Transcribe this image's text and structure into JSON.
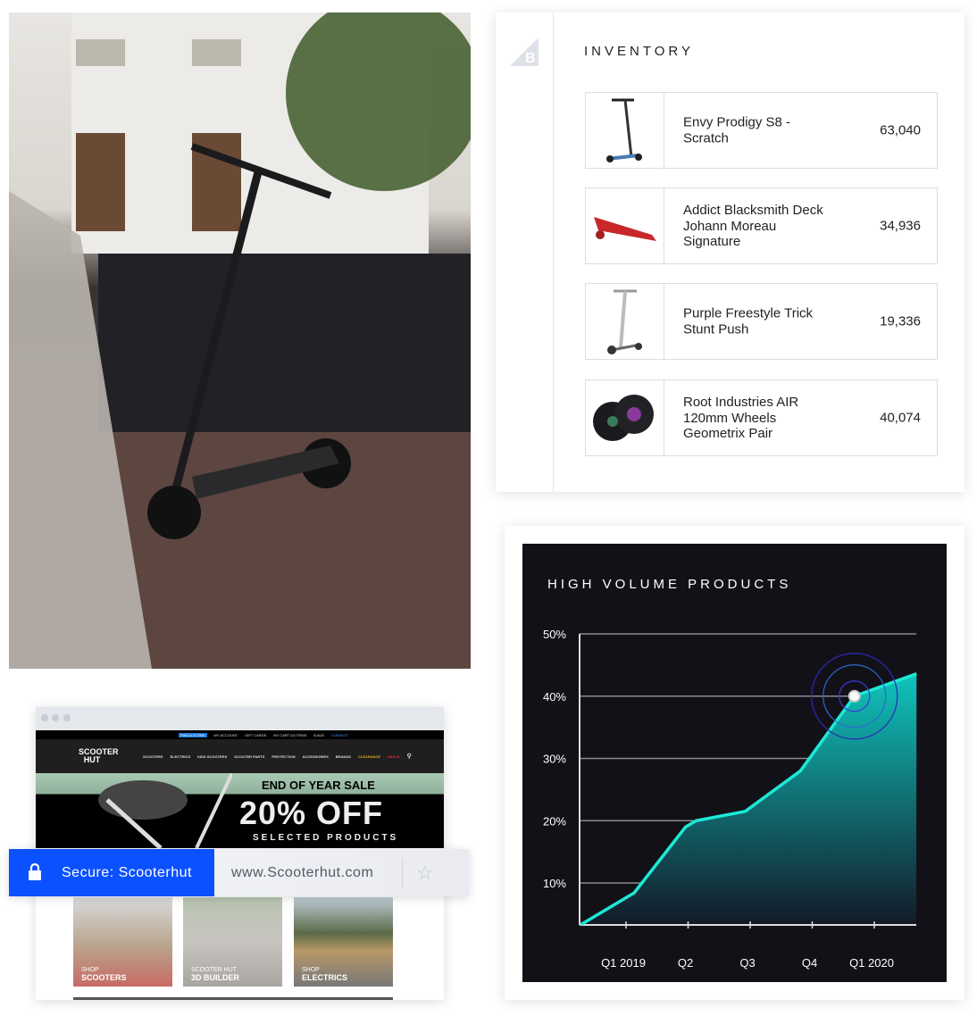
{
  "inventory": {
    "title": "INVENTORY",
    "logo": "B",
    "items": [
      {
        "name": "Envy Prodigy S8 - Scratch",
        "qty": "63,040",
        "thumb": "stunt-scooter"
      },
      {
        "name": "Addict Blacksmith Deck Johann Moreau Signature",
        "qty": "34,936",
        "thumb": "red-deck"
      },
      {
        "name": "Purple Freestyle Trick Stunt Push",
        "qty": "19,336",
        "thumb": "silver-scooter"
      },
      {
        "name": "Root Industries AIR 120mm Wheels Geometrix Pair",
        "qty": "40,074",
        "thumb": "wheels"
      }
    ]
  },
  "chart_data": {
    "type": "area",
    "title": "HIGH VOLUME PRODUCTS",
    "categories": [
      "Q1 2019",
      "Q2",
      "Q3",
      "Q4",
      "Q1 2020"
    ],
    "y_ticks": [
      "10%",
      "20%",
      "30%",
      "40%",
      "50%"
    ],
    "ylim": [
      3.3,
      50
    ],
    "points": [
      {
        "x": -0.73,
        "y": 3.3
      },
      {
        "x": 0.13,
        "y": 8.4
      },
      {
        "x": 0.96,
        "y": 19
      },
      {
        "x": 1.13,
        "y": 20
      },
      {
        "x": 1.92,
        "y": 21.5
      },
      {
        "x": 2.81,
        "y": 28
      },
      {
        "x": 3.68,
        "y": 40
      },
      {
        "x": 4.68,
        "y": 43.6
      }
    ],
    "highlight_point": {
      "x": 3.68,
      "y": 40
    },
    "grid": true,
    "line_color": "#1de9d6",
    "ring_color": "#3a3ad6"
  },
  "browser": {
    "topbar": [
      "FIND A STORE",
      "MY ACCOUNT",
      "GIFT CARDS",
      "MY CART (0) ITEMS",
      "$ AUD",
      "CONTACT"
    ],
    "logo": "SCOOTER HUT",
    "nav": [
      "SCOOTERS",
      "ELECTRICS",
      "KIDS SCOOTERS",
      "SCOOTER PARTS",
      "PROTECTION",
      "ACCESSORIES",
      "BRANDS",
      "CLEARANCE",
      "DEALS"
    ],
    "banner": {
      "line1": "END OF YEAR SALE",
      "line2": "20% OFF",
      "line3": "SELECTED PRODUCTS"
    },
    "tiles": [
      {
        "top": "SHOP",
        "bottom": "SCOOTERS"
      },
      {
        "top": "SCOOTER HUT",
        "bottom": "3D BUILDER"
      },
      {
        "top": "SHOP",
        "bottom": "ELECTRICS"
      }
    ],
    "secure_label": "Secure: Scooterhut",
    "url": "www.Scooterhut.com",
    "accent": "#0c51ff"
  }
}
